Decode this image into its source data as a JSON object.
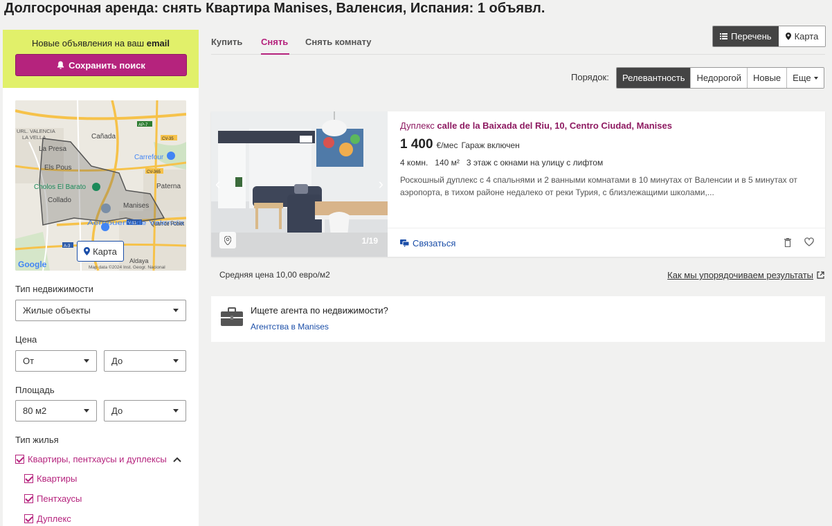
{
  "page": {
    "title": "Долгосрочная аренда: снять Квартира Manises, Валенсия, Испания: 1 объявл."
  },
  "sidebar": {
    "alert_text": "Новые объявления на ваш",
    "alert_text_bold": "email",
    "save_search": "Сохранить поиск",
    "map_button": "Карта",
    "map_labels": {
      "valencia": "URL. VALENCIA",
      "la_vella": "LA VELLA",
      "canada": "Cañada",
      "la_presa": "La Presa",
      "els_pous": "Els Pous",
      "carrefour": "Carrefour",
      "cholos": "Cholos El Barato",
      "paterna": "Paterna",
      "collado": "Collado",
      "manises": "Manises",
      "airport": "Aeropuerto de Valencia",
      "quart": "Quart de Poblet",
      "aldaya": "Aldaya",
      "ap7": "AP-7",
      "cv35": "CV-35",
      "cv365": "CV-365",
      "v11": "V-11",
      "a3": "A-3",
      "google": "Google",
      "copyright": "Map data ©2024 Inst. Geogr. Nacional"
    },
    "property_type_label": "Тип недвижимости",
    "property_type_value": "Жилые объекты",
    "price_label": "Цена",
    "price_from": "От",
    "price_to": "До",
    "area_label": "Площадь",
    "area_from": "80 м2",
    "area_to": "До",
    "housing_type_label": "Тип жилья",
    "housing_types": {
      "group": "Квартиры, пентхаусы и дуплексы",
      "flats": "Квартиры",
      "penthouses": "Пентхаусы",
      "duplexes": "Дуплекс"
    }
  },
  "tabs": {
    "buy": "Купить",
    "rent": "Снять",
    "rent_room": "Снять комнату"
  },
  "view": {
    "list": "Перечень",
    "map": "Карта"
  },
  "sort": {
    "label": "Порядок:",
    "relevance": "Релевантность",
    "cheap": "Недорогой",
    "new": "Новые",
    "more": "Еще"
  },
  "listing": {
    "type": "Дуплекс",
    "address": "calle de la Baixada del Riu, 10, Centro Ciudad, Manises",
    "price": "1 400",
    "price_unit": "€/мес",
    "price_extra": "Гараж включен",
    "details": "4 комн.   140 м²   3 этаж с окнами на улицу с лифтом",
    "description": "Роскошный дуплекс с 4 спальнями и 2 ванными комнатами в 10 минутах от Валенсии и в 5 минутах от аэропорта, в тихом районе недалеко от реки Турия, с близлежащими школами,...",
    "photo_counter": "1/19",
    "contact": "Связаться"
  },
  "summary": {
    "avg_price": "Средняя цена 10,00 евро/м2",
    "how_link": "Как мы упорядочиваем результаты"
  },
  "agent": {
    "title": "Ищете агента по недвижимости?",
    "link": "Агентства в Manises"
  },
  "colors": {
    "brand": "#b5237d",
    "alert_bg": "#e1f06a",
    "link": "#1b4ea8"
  }
}
